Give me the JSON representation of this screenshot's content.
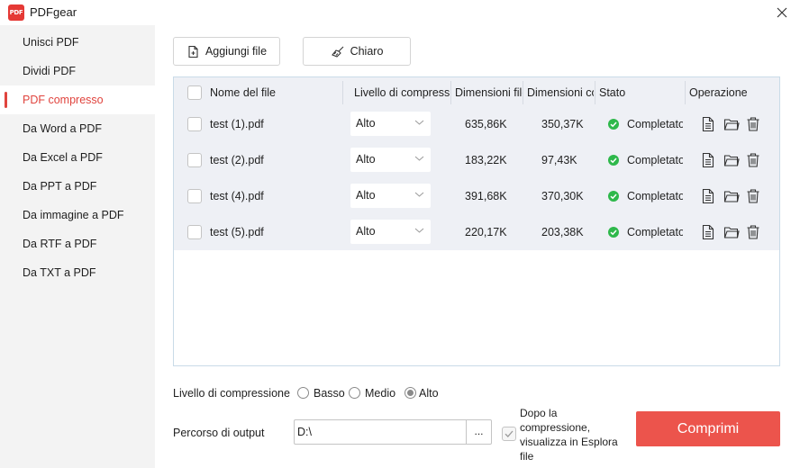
{
  "window": {
    "title": "PDFgear",
    "logo_text": "PDF"
  },
  "sidebar": {
    "items": [
      {
        "label": "Unisci PDF"
      },
      {
        "label": "Dividi PDF"
      },
      {
        "label": "PDF compresso",
        "active": true
      },
      {
        "label": "Da Word a PDF"
      },
      {
        "label": "Da Excel a PDF"
      },
      {
        "label": "Da PPT a PDF"
      },
      {
        "label": "Da immagine a PDF"
      },
      {
        "label": "Da RTF a PDF"
      },
      {
        "label": "Da TXT a PDF"
      }
    ]
  },
  "toolbar": {
    "add_files_label": "Aggiungi file",
    "clear_label": "Chiaro"
  },
  "table": {
    "headers": {
      "name": "Nome del file",
      "level": "Livello di compressione",
      "original_size": "Dimensioni file",
      "compressed_size": "Dimensioni compresse",
      "status": "Stato",
      "operation": "Operazione"
    },
    "rows": [
      {
        "name": "test (1).pdf",
        "level": "Alto",
        "original_size": "635,86K",
        "compressed_size": "350,37K",
        "status": "Completato"
      },
      {
        "name": "test (2).pdf",
        "level": "Alto",
        "original_size": "183,22K",
        "compressed_size": "97,43K",
        "status": "Completato"
      },
      {
        "name": "test (4).pdf",
        "level": "Alto",
        "original_size": "391,68K",
        "compressed_size": "370,30K",
        "status": "Completato"
      },
      {
        "name": "test (5).pdf",
        "level": "Alto",
        "original_size": "220,17K",
        "compressed_size": "203,38K",
        "status": "Completato"
      }
    ]
  },
  "compression": {
    "label": "Livello di compressione",
    "options": [
      "Basso",
      "Medio",
      "Alto"
    ],
    "selected": "Alto"
  },
  "output": {
    "label": "Percorso di output",
    "path": "D:\\",
    "browse_label": "...",
    "explorer_option": "Dopo la compressione, visualizza in Esplora file",
    "explorer_checked": true
  },
  "compress_button": "Comprimi",
  "colors": {
    "accent": "#e0443e",
    "compress_button": "#ec544c",
    "status_ok": "#2eb84b"
  }
}
